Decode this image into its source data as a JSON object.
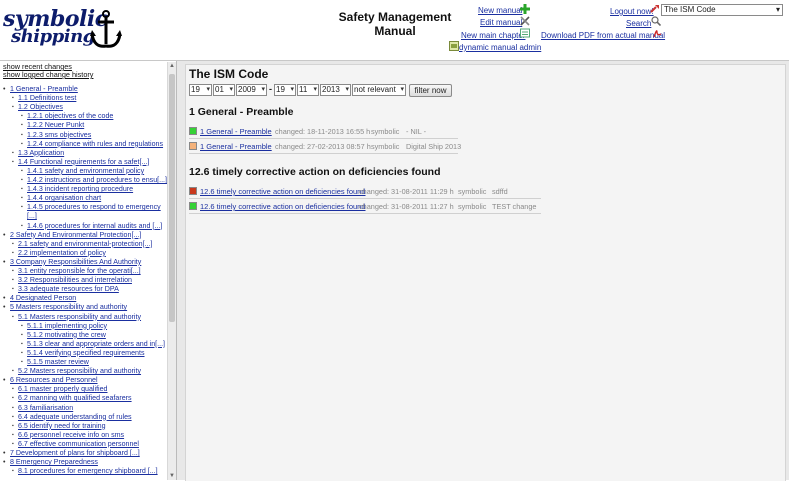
{
  "header": {
    "logo_line1": "symbolic",
    "logo_line2": "shipping",
    "title_line1": "Safety Management",
    "title_line2": "Manual",
    "links": {
      "new_manual": "New manual",
      "edit_manual": "Edit manual",
      "new_main_chapter": "New main chapter",
      "dynamic_manual_admin": "dynamic manual admin",
      "logout": "Logout now!",
      "search": "Search",
      "download_pdf": "Download PDF from actual manual"
    },
    "document_select": "The ISM Code"
  },
  "sidebar": {
    "show_recent": "show recent changes",
    "show_history": "show logged change history",
    "tree": [
      "1 General - Preamble",
      "1.1 Definitions test",
      "1.2 Objectives",
      "1.2.1 objectives of the code",
      "1.2.2 Neuer Punkt",
      "1.2.3 sms objectives",
      "1.2.4 compliance with rules and regulations",
      "1.3 Application",
      "1.4 Functional requirements for a safet[...]",
      "1.4.1 safety and environmental policy",
      "1.4.2 instructions and procedures to ensu[...]",
      "1.4.3 incident reporting procedure",
      "1.4.4 organisation chart",
      "1.4.5 procedures to respond to emergency",
      "[...]",
      "1.4.6 procedures for internal audits and [...]",
      "2 Safety And Environmental Protection[...]",
      "2.1 safety and environmental-protection[...]",
      "2.2 implementation of policy",
      "3 Company Responsibilities And Authority",
      "3.1 entity responsible for the operati[...]",
      "3.2 Responsibilities and interrelation",
      "3.3 adequate resources for DPA",
      "4 Designated Person",
      "5 Masters responsibility and authority",
      "5.1 Masters responsibility and authority",
      "5.1.1 implementing policy",
      "5.1.2 motivating the crew",
      "5.1.3 clear and appropriate orders and in[...]",
      "5.1.4 verifying specified requirements",
      "5.1.5 master review",
      "5.2 Masters responsibility and authority",
      "6 Resources and Personnel",
      "6.1 master properly qualified",
      "6.2 manning with qualified seafarers",
      "6.3 familiarisation",
      "6.4 adequate understanding of rules",
      "6.5 identify need for training",
      "6.6 personnel receive info on sms",
      "6.7 effective communication personnel",
      "7 Development of plans for shipboard [...]",
      "8 Emergency Preparedness",
      "8.1 procedures for emergency shipboard [...]"
    ]
  },
  "main": {
    "title": "The ISM Code",
    "filter": {
      "from_day": "19",
      "from_month": "01",
      "from_year": "2009",
      "to_day": "19",
      "to_month": "11",
      "to_year": "2013",
      "relevance": "not relevant",
      "button": "filter now"
    },
    "sections": [
      {
        "heading": "1 General - Preamble",
        "rows": [
          {
            "color": "#35d135",
            "link": "1 General - Preamble",
            "changed": "changed: 18-11-2013 16:55 h",
            "user": "symbolic",
            "note": "- NIL -"
          },
          {
            "color": "#f4b27a",
            "link": "1 General - Preamble",
            "changed": "changed: 27-02-2013 08:57 h",
            "user": "symbolic",
            "note": "Digital Ship 2013"
          }
        ]
      },
      {
        "heading": "12.6 timely corrective action on deficiencies found",
        "rows": [
          {
            "color": "#c8381c",
            "link": "12.6 timely corrective action on deficiencies found",
            "changed": "changed: 31-08-2011 11:29 h",
            "user": "symbolic",
            "note": "sdffd"
          },
          {
            "color": "#35d135",
            "link": "12.6 timely corrective action on deficiencies found",
            "changed": "changed: 31-08-2011 11:27 h",
            "user": "symbolic",
            "note": "TEST change"
          }
        ]
      }
    ]
  }
}
